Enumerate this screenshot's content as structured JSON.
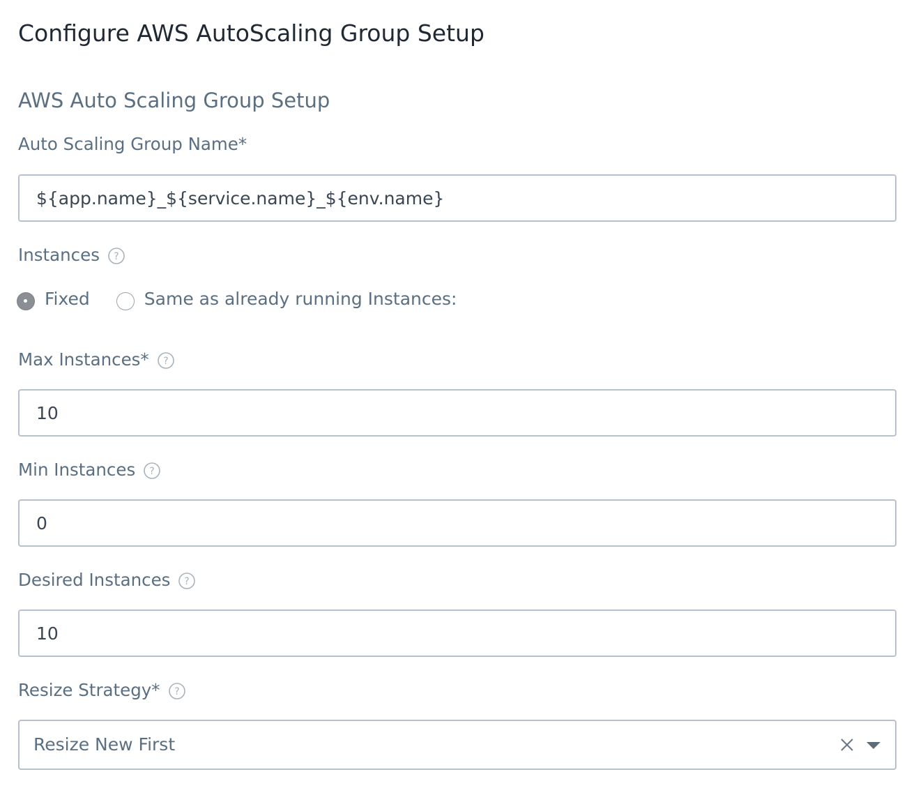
{
  "dialog": {
    "title": "Configure AWS AutoScaling Group Setup"
  },
  "section": {
    "title": "AWS Auto Scaling Group Setup"
  },
  "asg_name": {
    "label": "Auto Scaling Group Name*",
    "value": "${app.name}_${service.name}_${env.name}"
  },
  "instances": {
    "label": "Instances",
    "help_icon": "question-circle-icon",
    "options": [
      {
        "label": "Fixed",
        "checked": true
      },
      {
        "label": "Same as already running Instances:",
        "checked": false
      }
    ]
  },
  "max_instances": {
    "label": "Max Instances*",
    "help_icon": "question-circle-icon",
    "value": "10"
  },
  "min_instances": {
    "label": "Min Instances",
    "help_icon": "question-circle-icon",
    "value": "0"
  },
  "desired_instances": {
    "label": "Desired Instances",
    "help_icon": "question-circle-icon",
    "value": "10"
  },
  "resize_strategy": {
    "label": "Resize Strategy*",
    "help_icon": "question-circle-icon",
    "value": "Resize New First",
    "clear_icon": "close-icon",
    "dropdown_icon": "chevron-down-icon"
  },
  "colors": {
    "title_text": "#1f2833",
    "label_text": "#5b6f82",
    "input_border": "#b8c1cb",
    "radio_checked": "#8b8f93"
  }
}
